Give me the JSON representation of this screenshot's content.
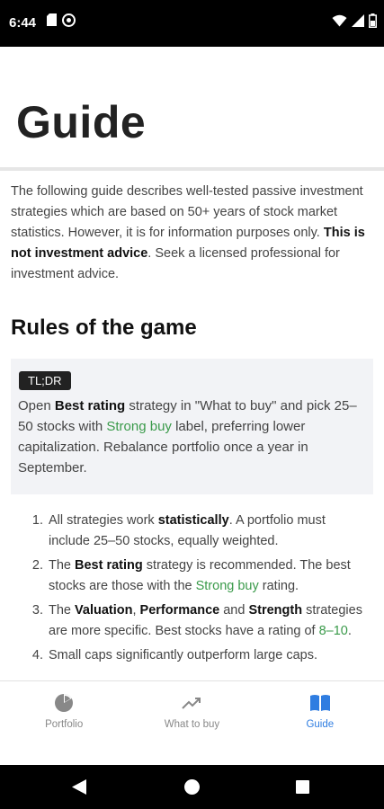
{
  "status_bar": {
    "time": "6:44"
  },
  "page": {
    "title": "Guide"
  },
  "intro": {
    "part1": "The following guide describes well-tested passive investment strategies which are based on 50+ years of stock market statistics. However, it is for information purposes only. ",
    "bold": "This is not investment advice",
    "part2": ". Seek a licensed professional for investment advice."
  },
  "rules_section": {
    "title": "Rules of the game",
    "tldr": {
      "badge": "TL;DR",
      "t1": "Open ",
      "t1_bold": "Best rating",
      "t2": " strategy in \"What to buy\" and pick 25–50 stocks with ",
      "t2_green": "Strong buy",
      "t3": " label, preferring lower capitalization. Rebalance portfolio once a year in September."
    },
    "items": [
      {
        "a": "All strategies work ",
        "a_bold": "statistically",
        "b": ". A portfolio must include 25–50 stocks, equally weighted."
      },
      {
        "a": "The ",
        "a_bold": "Best rating",
        "b": " strategy is recommended. The best stocks are those with the ",
        "b_green": "Strong buy",
        "c": " rating."
      },
      {
        "a": "The ",
        "a_bold": "Valuation",
        "b": ", ",
        "b_bold": "Performance",
        "c": " and ",
        "c_bold": "Strength",
        "d": " strategies are more specific. Best stocks have a rating of ",
        "d_green": "8–10",
        "e": "."
      },
      {
        "a": "Small caps significantly outperform large caps."
      }
    ]
  },
  "bottom_nav": {
    "items": [
      {
        "label": "Portfolio",
        "icon": "pie-chart-icon"
      },
      {
        "label": "What to buy",
        "icon": "trending-up-icon"
      },
      {
        "label": "Guide",
        "icon": "open-book-icon"
      }
    ],
    "active": "Guide",
    "active_color": "#2f7de1"
  },
  "colors": {
    "green": "#3a9a4a",
    "accent": "#2f7de1"
  }
}
